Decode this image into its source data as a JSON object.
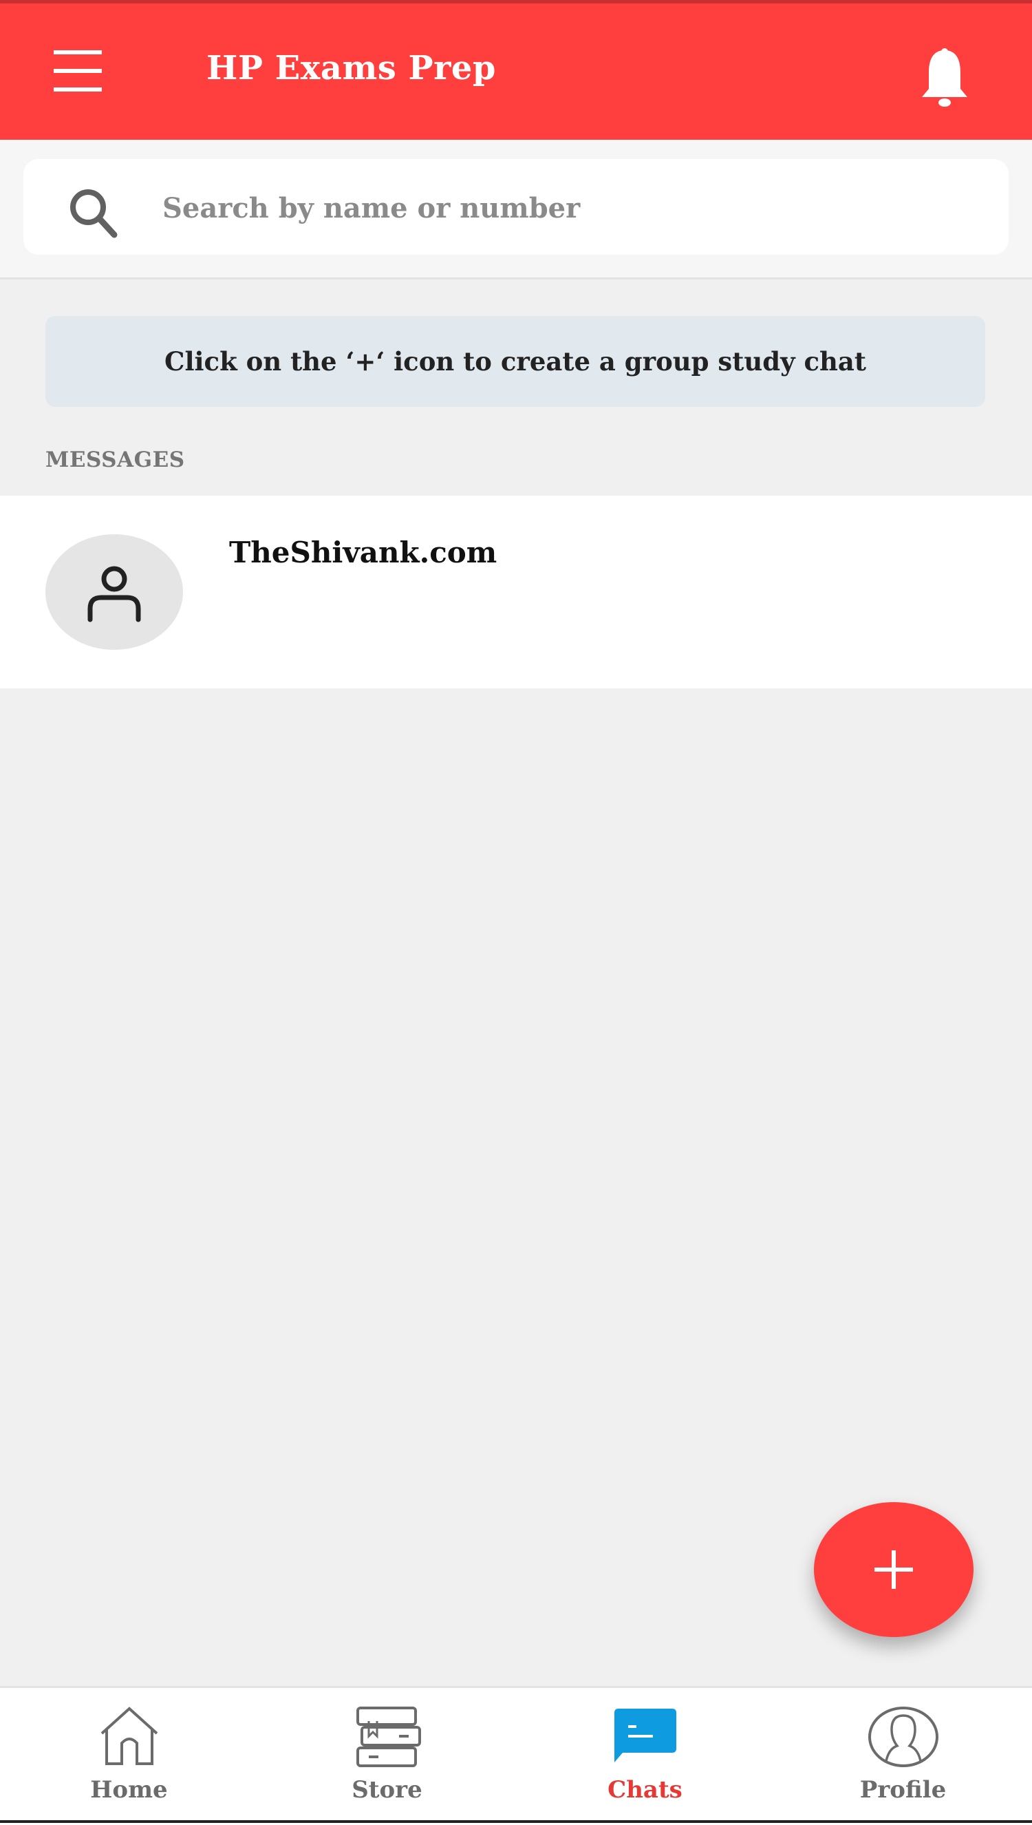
{
  "header": {
    "title": "HP Exams Prep",
    "menu_icon": "hamburger-menu-icon",
    "notification_icon": "bell-icon"
  },
  "search": {
    "icon": "search-icon",
    "placeholder": "Search by name or number",
    "value": ""
  },
  "banner": {
    "text": "Click on the ‘+‘ icon to create a group study chat"
  },
  "messages": {
    "section_label": "MESSAGES",
    "items": [
      {
        "name": "TheShivank.com",
        "avatar_icon": "person-icon"
      }
    ]
  },
  "fab": {
    "icon": "plus-icon",
    "label": "+"
  },
  "bottom_nav": {
    "items": [
      {
        "label": "Home",
        "icon": "home-icon",
        "active": false
      },
      {
        "label": "Store",
        "icon": "books-icon",
        "active": false
      },
      {
        "label": "Chats",
        "icon": "chat-bubble-icon",
        "active": true
      },
      {
        "label": "Profile",
        "icon": "profile-icon",
        "active": false
      }
    ]
  },
  "colors": {
    "brand_red": "#ff3f3d",
    "active_tab_label": "#e53935",
    "chat_icon_blue": "#0e9be0",
    "banner_bg": "#e1e9ef"
  }
}
